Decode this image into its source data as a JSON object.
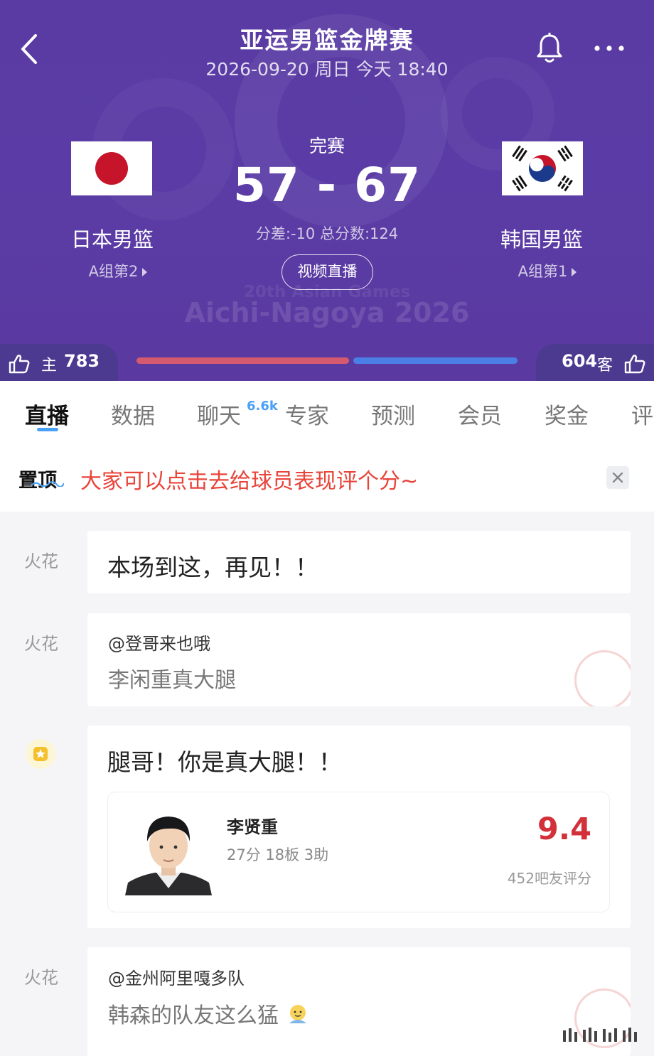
{
  "header": {
    "title": "亚运男篮金牌赛",
    "subtitle": "2026-09-20 周日 今天 18:40",
    "status": "完赛",
    "score": "57 - 67",
    "score_info": "分差:-10 总分数:124",
    "live_button": "视频直播",
    "watermark_line1": "20th Asian Games",
    "watermark_line2": "Aichi-Nagoya 2026",
    "home_team": {
      "name": "日本男篮",
      "rank": "A组第2",
      "flag": "japan-flag"
    },
    "away_team": {
      "name": "韩国男篮",
      "rank": "A组第1",
      "flag": "korea-flag"
    },
    "votes": {
      "home_label": "主",
      "home_count": "783",
      "away_label": "客",
      "away_count": "604",
      "home_fraction": 0.565
    },
    "icons": {
      "back": "chevron-left-icon",
      "bell": "bell-icon",
      "more": "more-dots-icon",
      "like": "thumbs-up-icon"
    }
  },
  "tabs": [
    {
      "label": "直播",
      "active": true
    },
    {
      "label": "数据"
    },
    {
      "label": "聊天",
      "badge": "6.6k"
    },
    {
      "label": "专家"
    },
    {
      "label": "预测"
    },
    {
      "label": "会员"
    },
    {
      "label": "奖金"
    },
    {
      "label": "评"
    }
  ],
  "pinned": {
    "label": "置顶",
    "text": "大家可以点击去给球员表现评个分~"
  },
  "messages": [
    {
      "sender": "火花",
      "text": "本场到这，再见！！"
    },
    {
      "sender": "火花",
      "reply_user": "@登哥来也哦",
      "reply_text": "李闲重真大腿"
    },
    {
      "sender_icon": "star-badge-icon",
      "text": "腿哥！你是真大腿！！",
      "player": {
        "name": "李贤重",
        "stats": "27分 18板 3助",
        "rating": "9.4",
        "rating_count": "452吧友评分"
      }
    },
    {
      "sender": "火花",
      "reply_user": "@金州阿里嘎多队",
      "reply_text": "韩森的队友这么猛"
    }
  ],
  "colors": {
    "header_bg": "#5a3ba3",
    "accent_blue": "#4aa0f5",
    "pin_red": "#e8443a",
    "rating_red": "#d3313a",
    "home_bar": "#d65a6e",
    "away_bar": "#4c7fe6"
  }
}
